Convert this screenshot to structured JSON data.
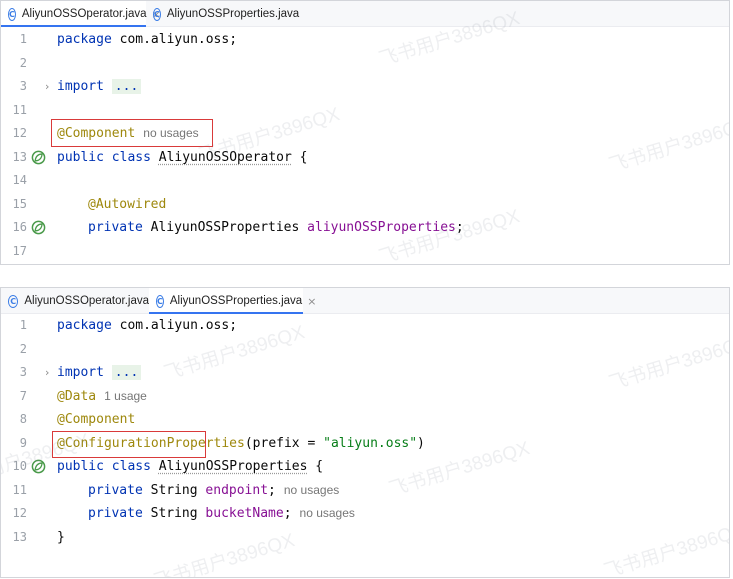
{
  "watermark": "飞书用户3896QX",
  "colors": {
    "tab_underline": "#3574f0",
    "keyword": "#0033b3",
    "annotation": "#9e880d",
    "field": "#871094",
    "string": "#067d17",
    "line_number": "#9aa0a8",
    "highlight_box": "#d93a3a",
    "spring_bean_icon": "#4a9a4a"
  },
  "icons": {
    "tab_file": "java-class-icon",
    "tab_close": "close-icon",
    "gutter": "spring-bean-icon",
    "fold": "chevron-right-icon"
  },
  "panel1": {
    "tabs": [
      {
        "label": "AliyunOSSOperator.java",
        "active": true,
        "close": "×"
      },
      {
        "label": "AliyunOSSProperties.java",
        "active": false
      }
    ],
    "lines": {
      "l1": {
        "num": "1",
        "t1": "package",
        "t2": " com.aliyun.oss;"
      },
      "l2": {
        "num": "2"
      },
      "l3": {
        "num": "3",
        "fold": "›",
        "t1": "import",
        "t2": " ",
        "folded": "..."
      },
      "l11": {
        "num": "11"
      },
      "l12": {
        "num": "12",
        "ann": "@Component",
        "hint": "no usages"
      },
      "l13": {
        "num": "13",
        "t1": "public class",
        "t2": " ",
        "t3": "AliyunOSSOperator",
        "t4": " {"
      },
      "l14": {
        "num": "14"
      },
      "l15": {
        "num": "15",
        "ann": "@Autowired"
      },
      "l16": {
        "num": "16",
        "t1": "private",
        "t2": " AliyunOSSProperties ",
        "fld": "aliyunOSSProperties",
        "t3": ";"
      },
      "l17": {
        "num": "17"
      }
    }
  },
  "panel2": {
    "tabs": [
      {
        "label": "AliyunOSSOperator.java",
        "active": false
      },
      {
        "label": "AliyunOSSProperties.java",
        "active": true,
        "close": "×"
      }
    ],
    "lines": {
      "l1": {
        "num": "1",
        "t1": "package",
        "t2": " com.aliyun.oss;"
      },
      "l2": {
        "num": "2"
      },
      "l3": {
        "num": "3",
        "fold": "›",
        "t1": "import",
        "t2": " ",
        "folded": "..."
      },
      "l7": {
        "num": "7",
        "ann": "@Data",
        "hint": "1 usage"
      },
      "l8": {
        "num": "8",
        "ann": "@Component"
      },
      "l9": {
        "num": "9",
        "ann": "@ConfigurationProperties",
        "t1": "(prefix = ",
        "str": "\"aliyun.oss\"",
        "t2": ")"
      },
      "l10": {
        "num": "10",
        "t1": "public class",
        "t2": " ",
        "t3": "AliyunOSSProperties",
        "t4": " {"
      },
      "l11": {
        "num": "11",
        "t1": "private",
        "t2": " String ",
        "fld": "endpoint",
        "t3": ";",
        "hint": "no usages"
      },
      "l12": {
        "num": "12",
        "t1": "private",
        "t2": " String ",
        "fld": "bucketName",
        "t3": ";",
        "hint": "no usages"
      },
      "l13": {
        "num": "13",
        "t1": "}"
      }
    }
  }
}
